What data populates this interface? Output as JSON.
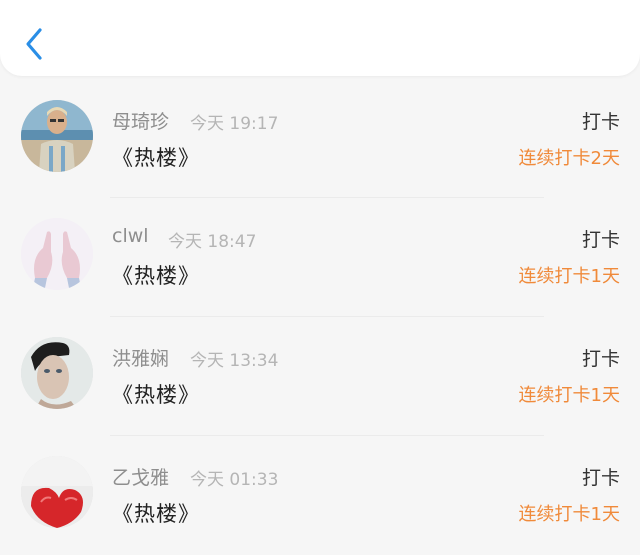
{
  "header": {
    "back_icon": "chevron-left-icon",
    "accent": "#2a8ee6"
  },
  "colors": {
    "streak": "#f08a3a"
  },
  "entries": [
    {
      "name": "母琦珍",
      "time": "今天 19:17",
      "book": "《热楼》",
      "action": "打卡",
      "streak": "连续打卡2天"
    },
    {
      "name": "clwl",
      "time": "今天 18:47",
      "book": "《热楼》",
      "action": "打卡",
      "streak": "连续打卡1天"
    },
    {
      "name": "洪雅娴",
      "time": "今天 13:34",
      "book": "《热楼》",
      "action": "打卡",
      "streak": "连续打卡1天"
    },
    {
      "name": "乙戈雅",
      "time": "今天 01:33",
      "book": "《热楼》",
      "action": "打卡",
      "streak": "连续打卡1天"
    }
  ]
}
